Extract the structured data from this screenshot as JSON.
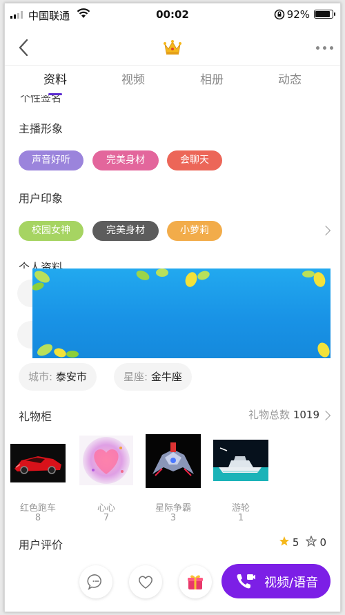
{
  "status_bar": {
    "carrier": "中国联通",
    "time": "00:02",
    "battery": "92%"
  },
  "navbar": {
    "back_icon": "chevron-left-icon",
    "center_icon": "crown-icon",
    "more_icon": "more-dots-icon"
  },
  "tabs": [
    {
      "label": "资料",
      "active": true
    },
    {
      "label": "视频",
      "active": false
    },
    {
      "label": "相册",
      "active": false
    },
    {
      "label": "动态",
      "active": false
    }
  ],
  "clipped_heading": "个性签名",
  "anchor_image": {
    "title": "主播形象",
    "tags": [
      {
        "label": "声音好听",
        "color": "#9b84dc"
      },
      {
        "label": "完美身材",
        "color": "#e3669c"
      },
      {
        "label": "会聊天",
        "color": "#ec6658"
      }
    ]
  },
  "user_impression": {
    "title": "用户印象",
    "tags": [
      {
        "label": "校园女神",
        "color": "#a6d462"
      },
      {
        "label": "完美身材",
        "color": "#5c5c5c"
      },
      {
        "label": "小萝莉",
        "color": "#f2ac4a"
      }
    ]
  },
  "profile": {
    "title": "个人资料",
    "city_label": "城市:",
    "city_value": "泰安市",
    "zodiac_label": "星座:",
    "zodiac_value": "金牛座"
  },
  "gift_cabinet": {
    "title": "礼物柜",
    "total_label": "礼物总数",
    "total_value": "1019",
    "items": [
      {
        "name": "红色跑车",
        "count": "8",
        "icon": "red-sports-car"
      },
      {
        "name": "心心",
        "count": "7",
        "icon": "heart"
      },
      {
        "name": "星际争霸",
        "count": "3",
        "icon": "star-battle-mech"
      },
      {
        "name": "游轮",
        "count": "1",
        "icon": "cruise-ship"
      }
    ]
  },
  "reviews": {
    "title": "用户评价",
    "good_count": "5",
    "bad_count": "0"
  },
  "bottom_bar": {
    "call_label": "视频/语音"
  },
  "colors": {
    "accent": "#5b2bd0",
    "call_button": "#7c1fe6",
    "banner": "#1a96e8"
  }
}
